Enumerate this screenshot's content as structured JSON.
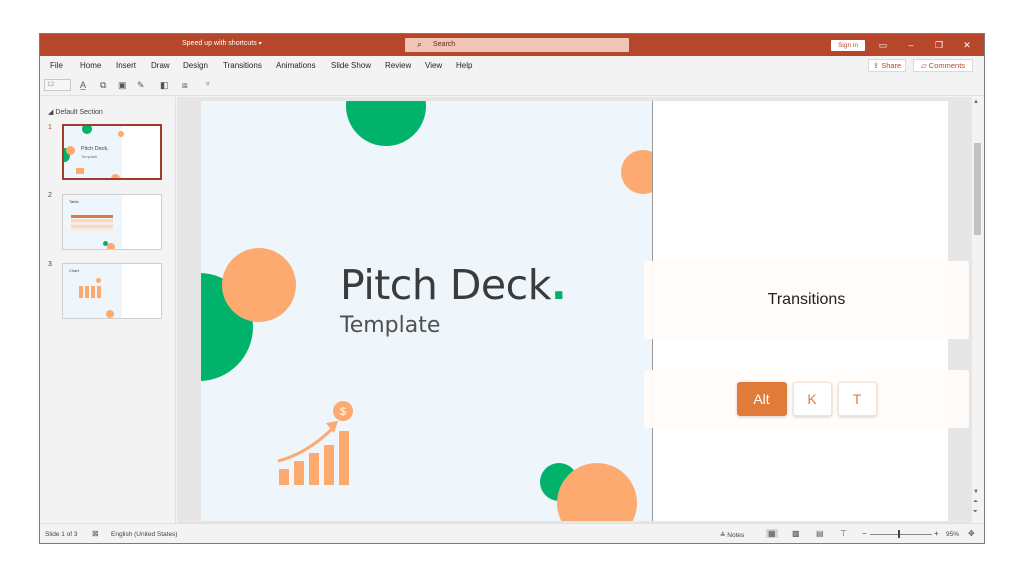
{
  "titlebar": {
    "tip": "Speed up with shortcuts",
    "tip_caret": "▾",
    "search_placeholder": "Search",
    "signin_label": "Sign in"
  },
  "menu": {
    "items": [
      "File",
      "Home",
      "Insert",
      "Draw",
      "Design",
      "Transitions",
      "Animations",
      "Slide Show",
      "Review",
      "View",
      "Help"
    ],
    "share_label": "Share",
    "comments_label": "Comments"
  },
  "ribbon": {
    "font_size": "12"
  },
  "slide_pane": {
    "section_label": "Default Section",
    "thumbnails": [
      {
        "number": "1",
        "title": "Pitch Deck.",
        "subtitle": "Template"
      },
      {
        "number": "2",
        "title": "Table."
      },
      {
        "number": "3",
        "title": "Chart."
      }
    ]
  },
  "slide": {
    "title": "Pitch Deck",
    "title_dot": ".",
    "subtitle": "Template",
    "chart_icon_symbol": "$"
  },
  "shortcut_overlay": {
    "command": "Transitions",
    "keys": [
      "Alt",
      "K",
      "T"
    ]
  },
  "statusbar": {
    "slide_indicator": "Slide 1 of 3",
    "language": "English (United States)",
    "notes_label": "Notes",
    "zoom_minus": "−",
    "zoom_plus": "+",
    "zoom_level": "95%"
  },
  "colors": {
    "accent_red": "#b7472a",
    "slide_green": "#00b26a",
    "slide_orange": "#fcaa6f",
    "key_orange": "#e07b39"
  }
}
